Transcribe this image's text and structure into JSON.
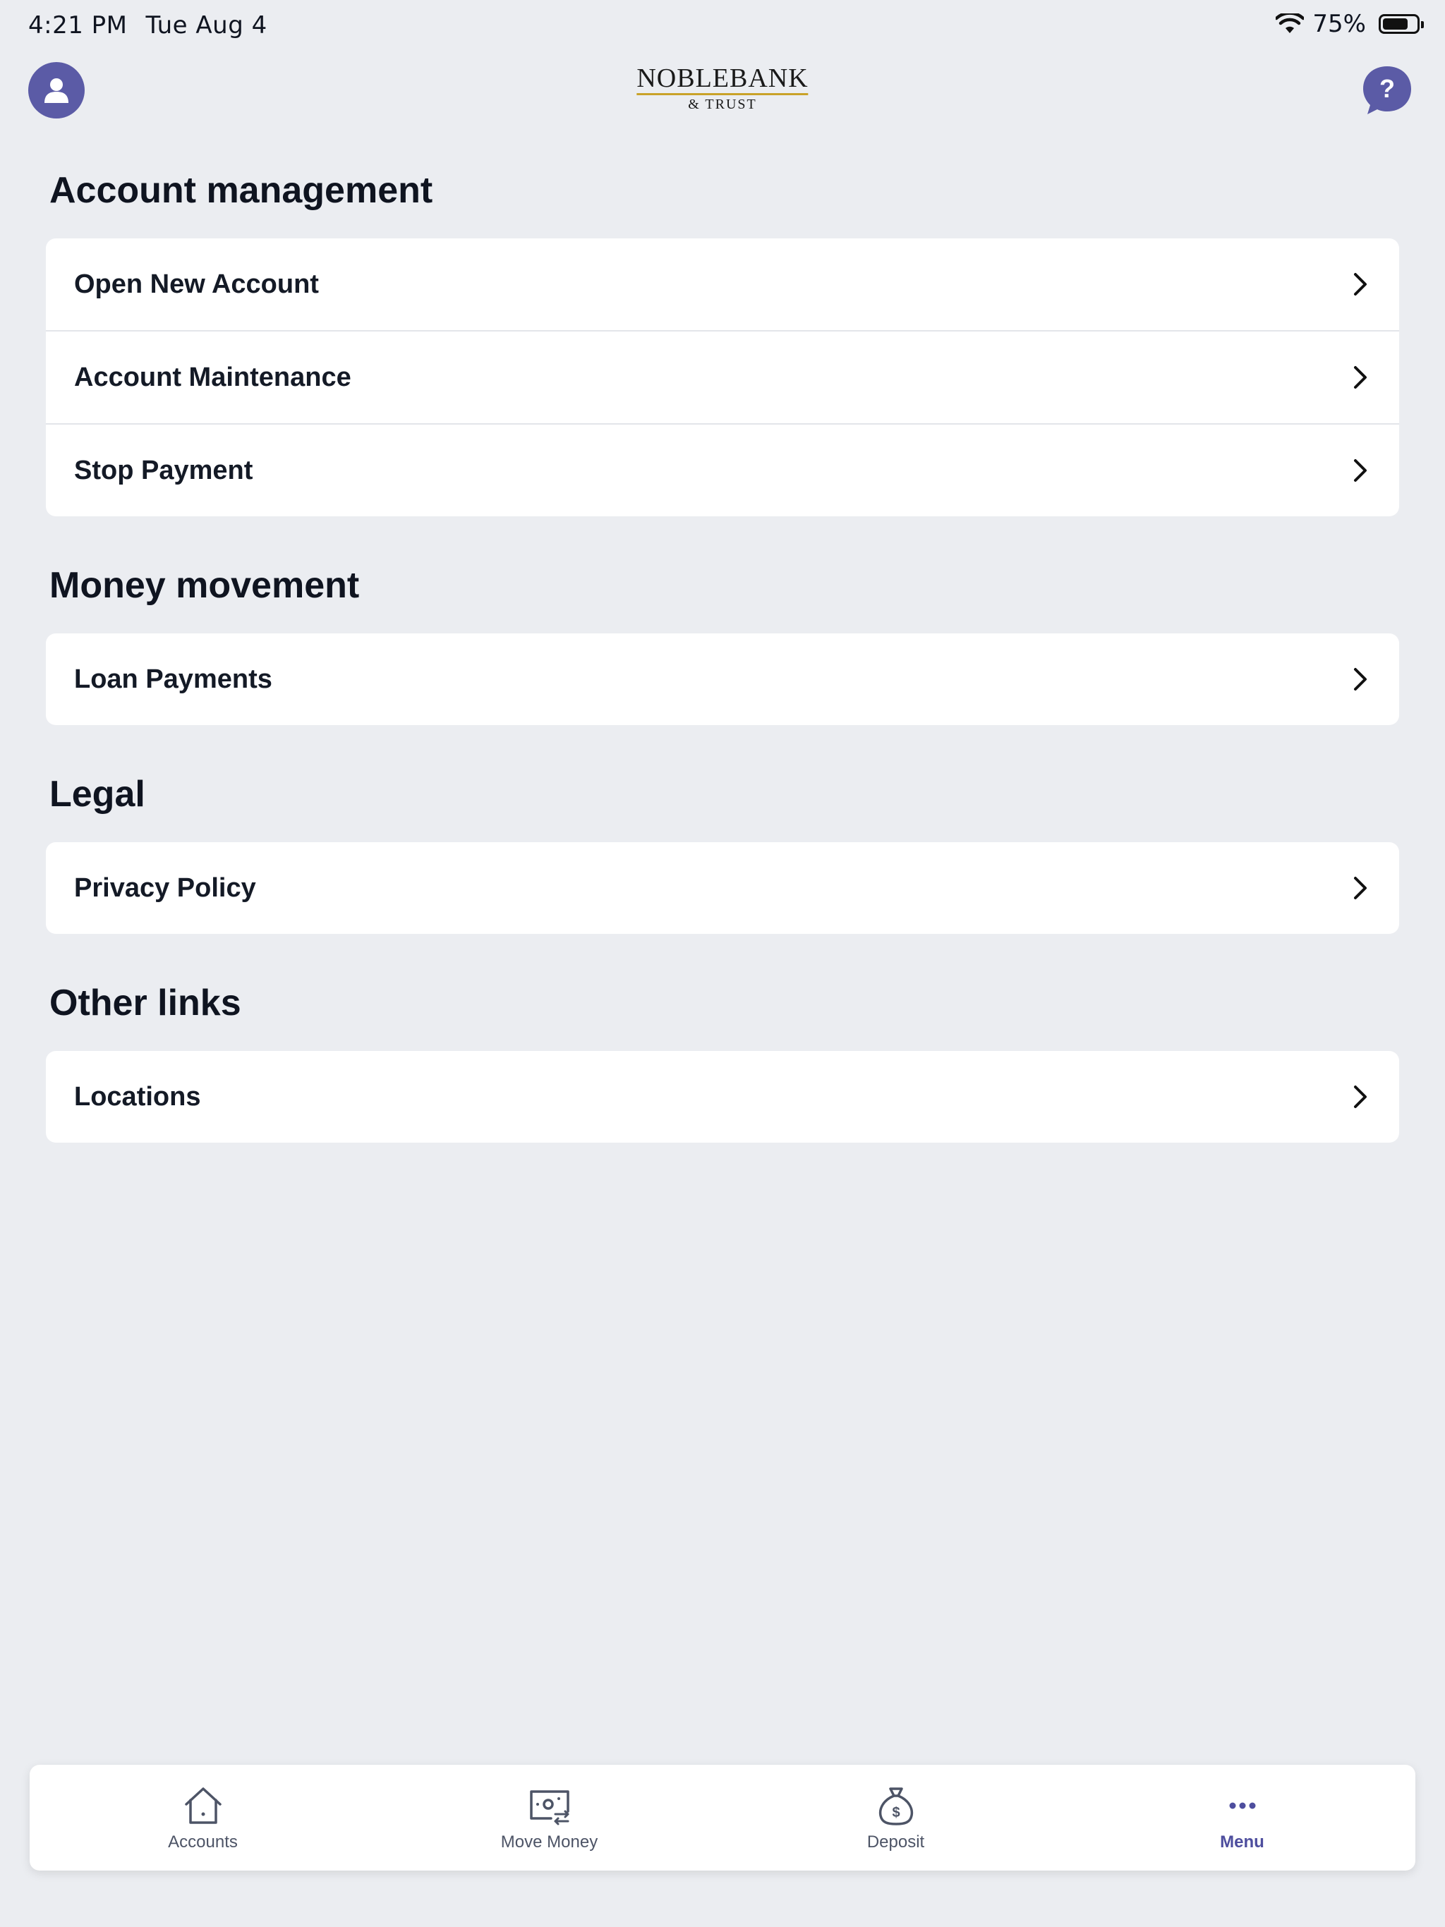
{
  "status_bar": {
    "time": "4:21 PM",
    "date": "Tue Aug 4",
    "battery_percent": "75%",
    "battery_level": 0.75
  },
  "header": {
    "logo_main": "NOBLEBANK",
    "logo_sub": "& TRUST",
    "avatar_icon": "person-icon",
    "help_icon": "question-bubble-icon"
  },
  "sections": [
    {
      "title": "Account management",
      "items": [
        "Open New Account",
        "Account Maintenance",
        "Stop Payment"
      ]
    },
    {
      "title": "Money movement",
      "items": [
        "Loan Payments"
      ]
    },
    {
      "title": "Legal",
      "items": [
        "Privacy Policy"
      ]
    },
    {
      "title": "Other links",
      "items": [
        "Locations"
      ]
    }
  ],
  "tab_bar": {
    "tabs": [
      {
        "label": "Accounts",
        "icon": "home-icon"
      },
      {
        "label": "Move Money",
        "icon": "money-transfer-icon"
      },
      {
        "label": "Deposit",
        "icon": "money-bag-icon"
      },
      {
        "label": "Menu",
        "icon": "more-dots-icon"
      }
    ],
    "active": "Menu"
  },
  "colors": {
    "background": "#ebedf1",
    "accent": "#5b5ba6",
    "active_tab": "#4e4e9e",
    "logo_underline": "#c9a229"
  }
}
